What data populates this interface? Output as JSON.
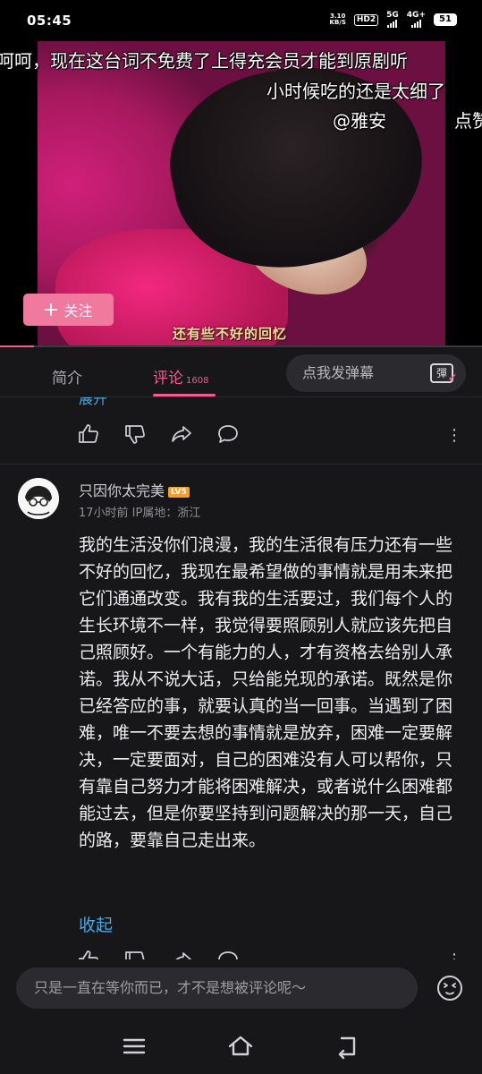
{
  "status_bar": {
    "time": "05:45",
    "net_speed_top": "3.10",
    "net_speed_bottom": "KB/S",
    "hd_label": "HD2",
    "signal_1": "5G",
    "signal_2": "4G+",
    "battery": "51"
  },
  "video": {
    "danmaku": [
      "呵呵，现在这台词不免费了上得充会员才能到原剧听",
      "小时候吃的还是太细了",
      "@雅安",
      "点赞"
    ],
    "subtitle": "还有些不好的回忆",
    "follow_button": "关注",
    "progress": 0.07
  },
  "tabs": {
    "intro": "简介",
    "comments": "评论",
    "comment_count": "1608",
    "danmaku_placeholder": "点我发弹幕",
    "danmaku_toggle": "彈"
  },
  "previous_comment": {
    "expand_label": "展开"
  },
  "comment": {
    "username": "只因你太完美",
    "level": "LV5",
    "meta": "17小时前 IP属地：浙江",
    "text": "我的生活没你们浪漫，我的生活很有压力还有一些不好的回忆，我现在最希望做的事情就是用未来把它们通通改变。我有我的生活要过，我们每个人的生长环境不一样，我觉得要照顾别人就应该先把自己照顾好。一个有能力的人，才有资格去给别人承诺。我从不说大话，只给能兑现的承诺。既然是你已经答应的事，就要认真的当一回事。当遇到了困难，唯一不要去想的事情就是放弃，困难一定要解决，一定要面对，自己的困难没有人可以帮你，只有靠自己努力才能将困难解决，或者说什么困难都能过去，但是你要坚持到问题解决的那一天，自己的路，要靠自己走出来。",
    "collapse_label": "收起"
  },
  "comment_bar": {
    "placeholder": "只是一直在等你而已，才不是想被评论呢～"
  },
  "colors": {
    "accent": "#f25d8e",
    "link": "#4aa7e0",
    "follow_button": "#f0799e",
    "background": "#17171a"
  }
}
